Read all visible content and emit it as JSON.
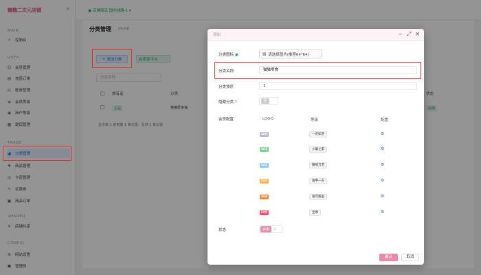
{
  "app": {
    "logo": "糖糖二次元店铺",
    "collapse_icon": "«"
  },
  "sidebar": {
    "sections": [
      {
        "label": "MAIN"
      },
      {
        "label": "USER"
      },
      {
        "label": "TRADE"
      },
      {
        "label": "SHARED"
      },
      {
        "label": "CONFIG"
      }
    ],
    "items": [
      {
        "label": "控制台",
        "icon": "✧"
      },
      {
        "label": "会员管理",
        "icon": "☺"
      },
      {
        "label": "充值订单",
        "icon": "▤"
      },
      {
        "label": "账单管理",
        "icon": "⚖"
      },
      {
        "label": "会员等级",
        "icon": "◈"
      },
      {
        "label": "商户等级",
        "icon": "◉"
      },
      {
        "label": "提现管理",
        "icon": "▦"
      },
      {
        "label": "分类管理",
        "icon": "◕"
      },
      {
        "label": "商品管理",
        "icon": "❖"
      },
      {
        "label": "卡密管理",
        "icon": "◎"
      },
      {
        "label": "优惠券",
        "icon": "✎"
      },
      {
        "label": "商品订单",
        "icon": "▣"
      },
      {
        "label": "店铺共享",
        "icon": "✕"
      },
      {
        "label": "网站设置",
        "icon": "⚙"
      },
      {
        "label": "管理员",
        "icon": "☗"
      }
    ]
  },
  "topbar": {
    "store_label": "▣ 店铺商店",
    "line_label": "国内线路-1 ▾"
  },
  "page": {
    "title": "分类管理",
    "subtitle": "(Build)",
    "add_button": "添加分类",
    "sort_button": "启用至平台",
    "search_placeholder": "分类名称",
    "columns": [
      "拥有者",
      "分类",
      "状态"
    ],
    "row": {
      "owner": "主站",
      "category": "猫猫零食铺",
      "status": "启用"
    },
    "pager": "显示第 1 条到第 1 条记录，总共 1 条记录"
  },
  "modal": {
    "title": "添加",
    "controls": {
      "minimize": "−",
      "maximize": "⤢",
      "close": "✕"
    },
    "icon_label": "分类图标",
    "icon_required_mark": "",
    "upload_button": "请选择图片(推荐64*64)",
    "name_label": "分类名称",
    "name_value": "猫猫零食",
    "sort_label": "分类排序",
    "sort_value": "1",
    "hidden_label": "隐藏分类",
    "hidden_help": "?",
    "hidden_toggle": "否",
    "member_label": "会员配置",
    "member_columns": [
      "LOGO",
      "等级",
      "配置"
    ],
    "levels": [
      {
        "logo": "LV0",
        "color": "#b7bcc6",
        "name": "一贫如洗"
      },
      {
        "logo": "LV1",
        "color": "#7fd38e",
        "name": "小康之家"
      },
      {
        "logo": "LV2",
        "color": "#8ec6ff",
        "name": "腰缠万贯"
      },
      {
        "logo": "LV3",
        "color": "#ffb24d",
        "name": "富甲一方"
      },
      {
        "logo": "LV4",
        "color": "#ff8a3a",
        "name": "富可敌国"
      },
      {
        "logo": "LV5",
        "color": "#ff4d6d",
        "name": "至尊"
      }
    ],
    "config_icon": "⚙",
    "status_label": "状态",
    "status_value": "启用",
    "confirm": "确认",
    "cancel": "取消"
  }
}
